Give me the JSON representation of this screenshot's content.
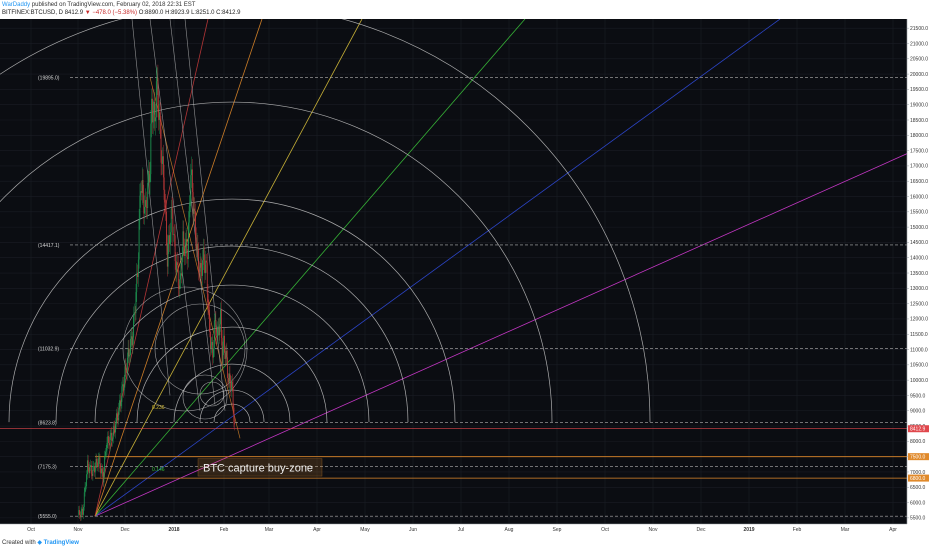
{
  "header": {
    "author": "WarDaddy",
    "published_text": " published on TradingView.com, February 02, 2018 22:31 EST",
    "symbol": "BITFINEX:BTCUSD, D",
    "last": "8412.9",
    "change": "▼ −478.0 (−5.38%)",
    "open": "O:8890.0",
    "high": "H:8923.9",
    "low": "L:8251.0",
    "close": "C:8412.9"
  },
  "footer": {
    "created_with": "Created with",
    "brand": "TradingView"
  },
  "colors": {
    "background": "#0b0d12",
    "grid": "#1a1d24",
    "up": "#1e9e55",
    "down": "#c43a3a",
    "arc": "#c8c8c8",
    "dashed": "#b0b0b0",
    "orange": "#e0892a",
    "magenta": "#d63bd6",
    "blue": "#2f4ad8",
    "green": "#3ac23a",
    "yellow": "#d9c03a",
    "last_price_tag": "#e0474c"
  },
  "chart_data": {
    "type": "candlestick",
    "y_axis_ticks": [
      "21500.0",
      "21000.0",
      "20500.0",
      "20000.0",
      "19500.0",
      "19000.0",
      "18500.0",
      "18000.0",
      "17500.0",
      "17000.0",
      "16500.0",
      "16000.0",
      "15500.0",
      "15000.0",
      "14500.0",
      "14000.0",
      "13500.0",
      "13000.0",
      "12500.0",
      "12000.0",
      "11500.0",
      "11000.0",
      "10500.0",
      "10000.0",
      "9500.0",
      "9000.0",
      "8500.0",
      "8000.0",
      "7500.0",
      "7000.0",
      "6500.0",
      "6000.0",
      "5500.0"
    ],
    "x_axis_ticks": [
      "Oct",
      "Nov",
      "Dec",
      "2018",
      "Feb",
      "Mar",
      "Apr",
      "May",
      "Jun",
      "Jul",
      "Aug",
      "Sep",
      "Oct",
      "Nov",
      "Dec",
      "2019",
      "Feb",
      "Mar",
      "Apr"
    ],
    "levels": [
      {
        "label": "(19895.0)",
        "value": 19895.0
      },
      {
        "label": "(14417.1)",
        "value": 14417.1
      },
      {
        "label": "(11032.9)",
        "value": 11032.9
      },
      {
        "label": "(8623.8)",
        "value": 8623.8
      },
      {
        "label": "(7175.3)",
        "value": 7175.3
      },
      {
        "label": "(5555.0)",
        "value": 5555.0
      }
    ],
    "fib_labels": [
      "0.236",
      "0.146"
    ],
    "buy_zone": {
      "label": "BTC capture buy-zone",
      "top": 7500,
      "bottom": 6800
    },
    "price_tags": [
      {
        "label": "8412.9",
        "value": 8412.9
      },
      {
        "label": "7500.0",
        "value": 7500.0
      },
      {
        "label": "6800.0",
        "value": 6800.0
      }
    ],
    "last_price": 8412.9,
    "ylim": [
      5300,
      21800
    ]
  }
}
